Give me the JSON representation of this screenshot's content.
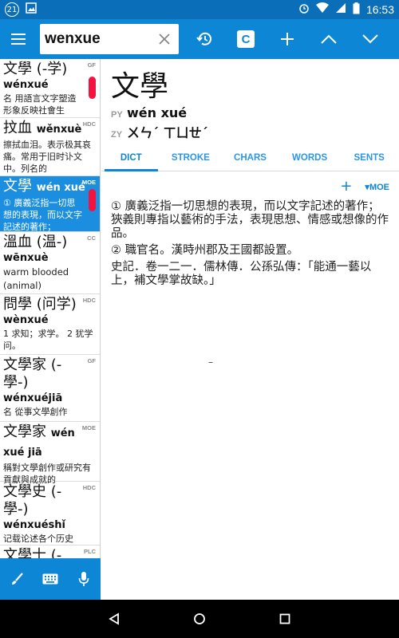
{
  "status_bar": {
    "notification_count": "21",
    "time": "16:53"
  },
  "search": {
    "value": "wenxue",
    "placeholder": ""
  },
  "toolbar": {
    "c_button_label": "C"
  },
  "entries": [
    {
      "headword": "文學 (-学)",
      "pinyin": "wénxué",
      "definition": "名 用語言文字塑造形象反映社會生",
      "source": "GF"
    },
    {
      "headword": "抆血",
      "headword_pinyin": "wěnxuè",
      "pinyin": "",
      "definition": "擦拭血泪。表示极其哀痛。常用于旧时讣文中。列名的",
      "source": "HDC"
    },
    {
      "headword": "文學",
      "headword_pinyin": "wén xué",
      "pinyin": "",
      "definition": "① 廣義泛指一切思想的表現，而以文字記述的著作；",
      "source": "MOE"
    },
    {
      "headword": "溫血 (温-)",
      "pinyin": "wēnxuè",
      "definition": "warm blooded (animal)",
      "source": "CC"
    },
    {
      "headword": "問學 (问学)",
      "pinyin": "wènxué",
      "definition": "1 求知；求学。 2 犹学问。",
      "source": "HDC"
    },
    {
      "headword": "文學家 (-學-)",
      "pinyin": "wénxuéjiā",
      "definition": "名 從事文學創作",
      "source": "GF"
    },
    {
      "headword": "文學家",
      "headword_pinyin": "wén xué jiā",
      "pinyin": "",
      "definition": "稱對文學創作或研究有貢獻與成就的",
      "source": "MOE"
    },
    {
      "headword": "文學史 (-學-)",
      "pinyin": "wénxuéshǐ",
      "definition": "记载论述各个历史",
      "source": "HDC"
    },
    {
      "headword": "文學士 (-",
      "pinyin": "",
      "definition": "",
      "source": "PLC"
    }
  ],
  "detail": {
    "headword": "文學",
    "py_tag": "PY",
    "pinyin": "wén xué",
    "zy_tag": "ZY",
    "zhuyin": "ㄨㄣˊ ㄒㄩㄝˊ",
    "tabs": [
      "DICT",
      "STROKE",
      "CHARS",
      "WORDS",
      "SENTS"
    ],
    "active_tab": "DICT",
    "add_label": "+",
    "source_label": "▾MOE",
    "definitions": [
      "① 廣義泛指一切思想的表現，而以文字記述的著作；狹義則專指以藝術的手法，表現思想、情感或想像的作品。",
      "② 職官名。漢時州郡及王國都設置。",
      "史記．卷一二一．儒林傳．公孫弘傳：「能通一藝以上，補文學掌故缺。」"
    ],
    "dash": "–"
  },
  "colors": {
    "appbar": "#0d86d6",
    "statusbar": "#0a6fb8",
    "selected": "#1b8ee0",
    "accent_tab": "#2a97e6",
    "scroll_marker": "#f4123f"
  }
}
